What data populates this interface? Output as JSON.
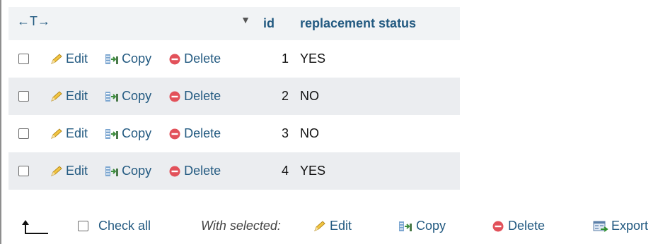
{
  "header": {
    "arrows_glyph": "←T→",
    "sort_glyph": "▼",
    "columns": [
      "id",
      "replacement status"
    ]
  },
  "row_actions": {
    "edit": "Edit",
    "copy": "Copy",
    "delete": "Delete"
  },
  "rows": [
    {
      "id": "1",
      "status": "YES"
    },
    {
      "id": "2",
      "status": "NO"
    },
    {
      "id": "3",
      "status": "NO"
    },
    {
      "id": "4",
      "status": "YES"
    }
  ],
  "footer": {
    "check_all": "Check all",
    "with_selected": "With selected:",
    "edit": "Edit",
    "copy": "Copy",
    "delete": "Delete",
    "export": "Export"
  },
  "colors": {
    "link": "#235a81",
    "header_bg": "#f1f3f5",
    "even_row_bg": "#ebedf0",
    "delete_red": "#e2515a",
    "pencil_yellow": "#f2c542"
  },
  "icons": [
    "pencil-icon",
    "copy-icon",
    "delete-icon",
    "export-icon",
    "arrow-up-corner-icon"
  ]
}
